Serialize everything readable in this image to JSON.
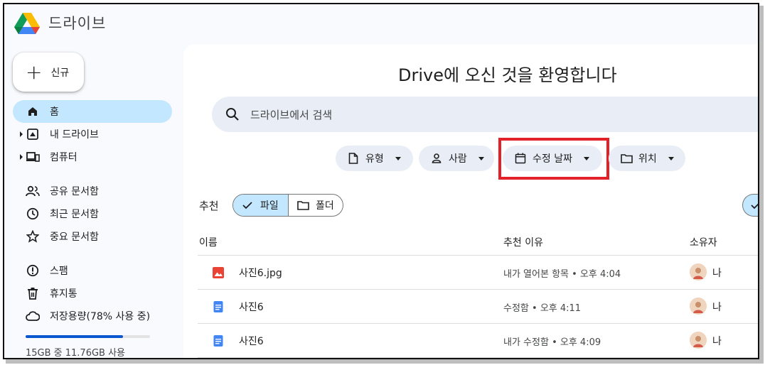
{
  "app": {
    "title": "드라이브"
  },
  "new_button": {
    "label": "신규"
  },
  "sidebar": {
    "items": [
      {
        "label": "홈",
        "icon": "home-icon",
        "active": true
      },
      {
        "label": "내 드라이브",
        "icon": "my-drive-icon",
        "expandable": true
      },
      {
        "label": "컴퓨터",
        "icon": "computers-icon",
        "expandable": true
      },
      {
        "label": "공유 문서함",
        "icon": "shared-icon"
      },
      {
        "label": "최근 문서함",
        "icon": "recent-icon"
      },
      {
        "label": "중요 문서함",
        "icon": "star-icon"
      },
      {
        "label": "스팸",
        "icon": "spam-icon"
      },
      {
        "label": "휴지통",
        "icon": "trash-icon"
      },
      {
        "label": "저장용량(78% 사용 중)",
        "icon": "cloud-icon"
      }
    ],
    "storage": {
      "used_percent": 78,
      "text": "15GB 중 11.76GB 사용"
    }
  },
  "main": {
    "welcome": "Drive에 오신 것을 환영합니다",
    "search_placeholder": "드라이브에서 검색",
    "filters": [
      {
        "label": "유형",
        "icon": "file-icon"
      },
      {
        "label": "사람",
        "icon": "person-icon"
      },
      {
        "label": "수정 날짜",
        "icon": "calendar-icon",
        "highlighted": true
      },
      {
        "label": "위치",
        "icon": "folder-icon"
      }
    ],
    "suggested": {
      "label": "추천",
      "toggle": [
        {
          "label": "파일",
          "icon": "check-icon",
          "selected": true
        },
        {
          "label": "폴더",
          "icon": "folder-icon",
          "selected": false
        }
      ]
    },
    "table": {
      "columns": [
        "이름",
        "추천 이유",
        "소유자"
      ],
      "rows": [
        {
          "name": "사진6.jpg",
          "type": "image",
          "reason": "내가 열어본 항목 • 오후 4:04",
          "owner": "나"
        },
        {
          "name": "사진6",
          "type": "doc",
          "reason": "수정함 • 오후 4:11",
          "owner": "나"
        },
        {
          "name": "사진6",
          "type": "doc",
          "reason": "내가 수정함 • 오후 4:09",
          "owner": "나"
        }
      ]
    }
  },
  "colors": {
    "accent": "#c2e7ff",
    "highlight": "#e32129",
    "storage_bar": "#0b57d0"
  }
}
